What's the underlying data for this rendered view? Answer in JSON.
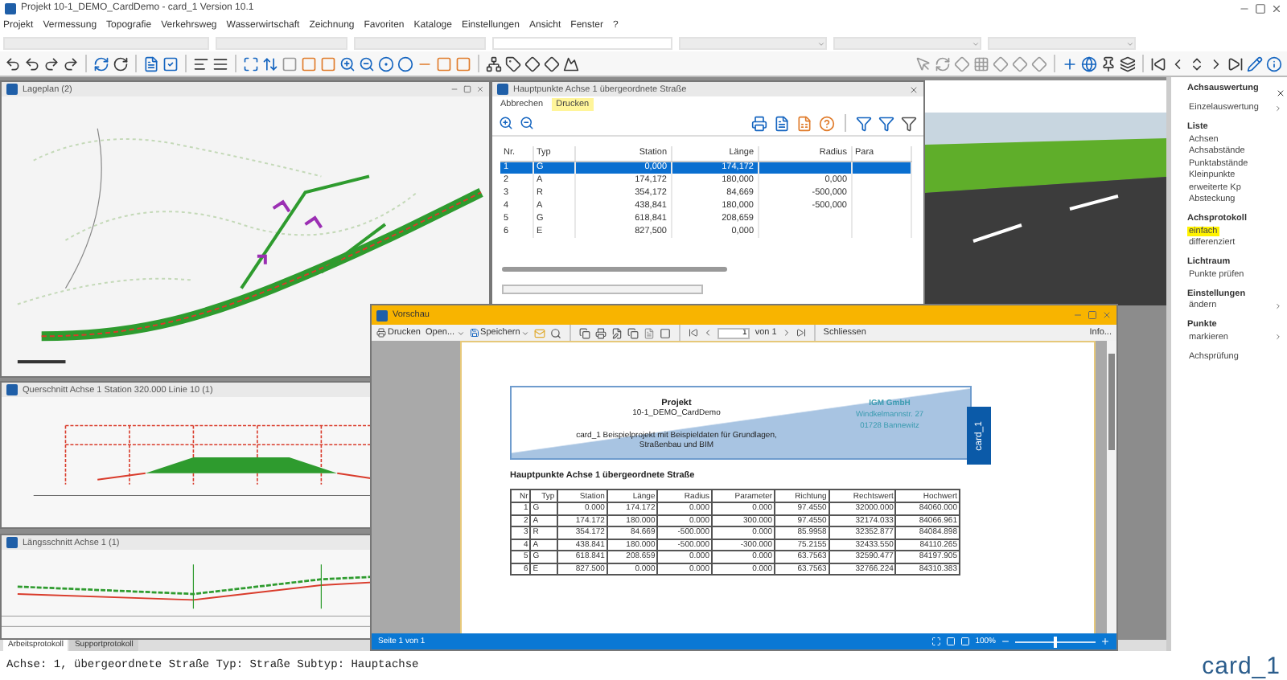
{
  "window": {
    "title": "Projekt 10-1_DEMO_CardDemo - card_1 Version 10.1"
  },
  "menu": [
    "Projekt",
    "Vermessung",
    "Topografie",
    "Verkehrsweg",
    "Wasserwirtschaft",
    "Zeichnung",
    "Favoriten",
    "Kataloge",
    "Einstellungen",
    "Ansicht",
    "Fenster",
    "?"
  ],
  "mdi_windows": [
    {
      "kind": "plan",
      "title": "Lageplan (2)"
    },
    {
      "kind": "cross",
      "title": "Querschnitt Achse 1 Station 320.000 Linie 10 (1)"
    },
    {
      "kind": "long",
      "title": "Längsschnitt Achse 1 (1)"
    }
  ],
  "axis_dialog": {
    "title": "Hauptpunkte Achse 1 übergeordnete Straße",
    "menu": [
      {
        "label": "Abbrechen",
        "selected": false
      },
      {
        "label": "Drucken",
        "selected": true
      }
    ],
    "columns": [
      "Nr.",
      "Typ",
      "Station",
      "Länge",
      "Radius",
      "Para"
    ],
    "progress": {
      "level": 0
    },
    "rows": [
      {
        "cells": [
          "1",
          "G",
          "0,000",
          "174,172",
          ""
        ],
        "selected": true
      },
      {
        "cells": [
          "2",
          "A",
          "174,172",
          "180,000",
          "0,000"
        ],
        "selected": false
      },
      {
        "cells": [
          "3",
          "R",
          "354,172",
          "84,669",
          "-500,000"
        ],
        "selected": false
      },
      {
        "cells": [
          "4",
          "A",
          "438,841",
          "180,000",
          "-500,000"
        ],
        "selected": false
      },
      {
        "cells": [
          "5",
          "G",
          "618,841",
          "208,659",
          ""
        ],
        "selected": false
      },
      {
        "cells": [
          "6",
          "E",
          "827,500",
          "0,000",
          ""
        ],
        "selected": false
      }
    ]
  },
  "preview": {
    "title": "Vorschau",
    "print": "Drucken",
    "open": "Open...",
    "save": "Speichern",
    "page_input": "1",
    "page_total": "von 1",
    "close": "Schliessen",
    "info": "Info...",
    "header": {
      "label": "Projekt",
      "project": "10-1_DEMO_CardDemo",
      "description": "card_1 Beispielprojekt mit Beispieldaten für Grundlagen, Straßenbau und BIM",
      "company": "IGM GmbH",
      "street": "Windkelmannstr. 27",
      "city": "01728 Bannewitz",
      "logo": "card_1"
    },
    "heading": "Hauptpunkte Achse 1 übergeordnete Straße",
    "columns": [
      "Nr",
      "Typ",
      "Station",
      "Länge",
      "Radius",
      "Parameter",
      "Richtung",
      "Rechtswert",
      "Hochwert"
    ],
    "rows": [
      [
        "1",
        "G",
        "0.000",
        "174.172",
        "0.000",
        "0.000",
        "97.4550",
        "32000.000",
        "84060.000"
      ],
      [
        "2",
        "A",
        "174.172",
        "180.000",
        "0.000",
        "300.000",
        "97.4550",
        "32174.033",
        "84066.961"
      ],
      [
        "3",
        "R",
        "354.172",
        "84.669",
        "-500.000",
        "0.000",
        "85.9958",
        "32352.877",
        "84084.898"
      ],
      [
        "4",
        "A",
        "438.841",
        "180.000",
        "-500.000",
        "-300.000",
        "75.2155",
        "32433.550",
        "84110.265"
      ],
      [
        "5",
        "G",
        "618.841",
        "208.659",
        "0.000",
        "0.000",
        "63.7563",
        "32590.477",
        "84197.905"
      ],
      [
        "6",
        "E",
        "827.500",
        "0.000",
        "0.000",
        "0.000",
        "63.7563",
        "32766.224",
        "84310.383"
      ]
    ],
    "status": "Seite 1 von 1",
    "zoom": "100%",
    "zoom_slider": {
      "level": 0.5
    }
  },
  "side_panel": [
    {
      "heading": "Achsauswertung"
    },
    {
      "items": [
        {
          "label": "Einzelauswertung",
          "submenu": true,
          "selected": false
        }
      ]
    },
    {
      "heading": "Liste",
      "items": [
        {
          "label": "Achsen",
          "submenu": false,
          "selected": false
        },
        {
          "label": "Achsabstände",
          "submenu": false,
          "selected": false
        },
        {
          "label": "Punktabstände",
          "submenu": false,
          "selected": false
        },
        {
          "label": "Kleinpunkte",
          "submenu": false,
          "selected": false
        },
        {
          "label": "erweiterte Kp",
          "submenu": false,
          "selected": false
        },
        {
          "label": "Absteckung",
          "submenu": false,
          "selected": false
        }
      ]
    },
    {
      "heading": "Achsprotokoll",
      "items": [
        {
          "label": "einfach",
          "submenu": false,
          "selected": true
        },
        {
          "label": "differenziert",
          "submenu": false,
          "selected": false
        }
      ]
    },
    {
      "heading": "Lichtraum",
      "items": [
        {
          "label": "Punkte prüfen",
          "submenu": false,
          "selected": false
        }
      ]
    },
    {
      "heading": "Einstellungen",
      "items": [
        {
          "label": "ändern",
          "submenu": true,
          "selected": false
        }
      ]
    },
    {
      "heading": "Punkte",
      "items": [
        {
          "label": "markieren",
          "submenu": true,
          "selected": false
        }
      ]
    },
    {
      "items": [
        {
          "label": "Achsprüfung",
          "submenu": false,
          "selected": false
        }
      ]
    }
  ],
  "bottom_tabs": [
    {
      "label": "Arbeitsprotokoll",
      "selected": true
    },
    {
      "label": "Supportprotokoll",
      "selected": false
    }
  ],
  "status_line": "Achse: 1, übergeordnete Straße Typ: Straße Subtyp: Hauptachse",
  "logo": "card_1"
}
